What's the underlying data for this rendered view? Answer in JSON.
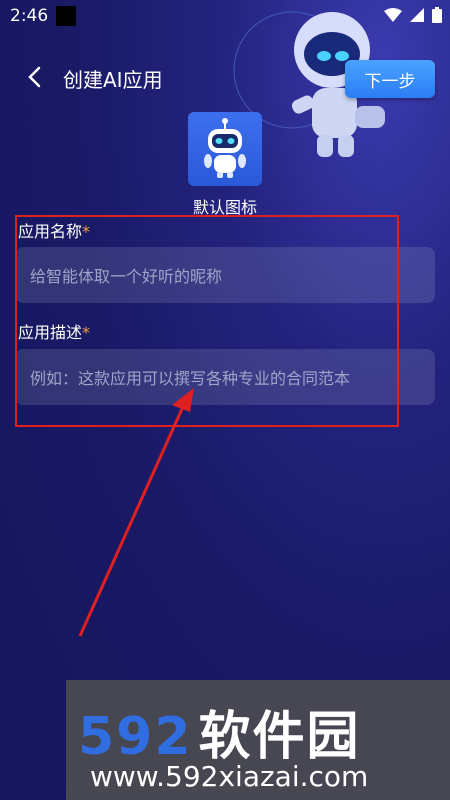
{
  "status": {
    "time": "2:46"
  },
  "header": {
    "title": "创建AI应用",
    "next_label": "下一步"
  },
  "icon": {
    "label": "默认图标"
  },
  "form": {
    "name_label": "应用名称",
    "name_placeholder": "给智能体取一个好听的昵称",
    "desc_label": "应用描述",
    "desc_placeholder": "例如：这款应用可以撰写各种专业的合同范本",
    "required_mark": "*"
  },
  "watermark": {
    "number": "592",
    "name": "软件园",
    "url": "www.592xiazai.com"
  },
  "colors": {
    "background": "#1a1a6e",
    "accent": "#2b7df4",
    "required": "#f0a040",
    "annotation": "#e02020"
  }
}
